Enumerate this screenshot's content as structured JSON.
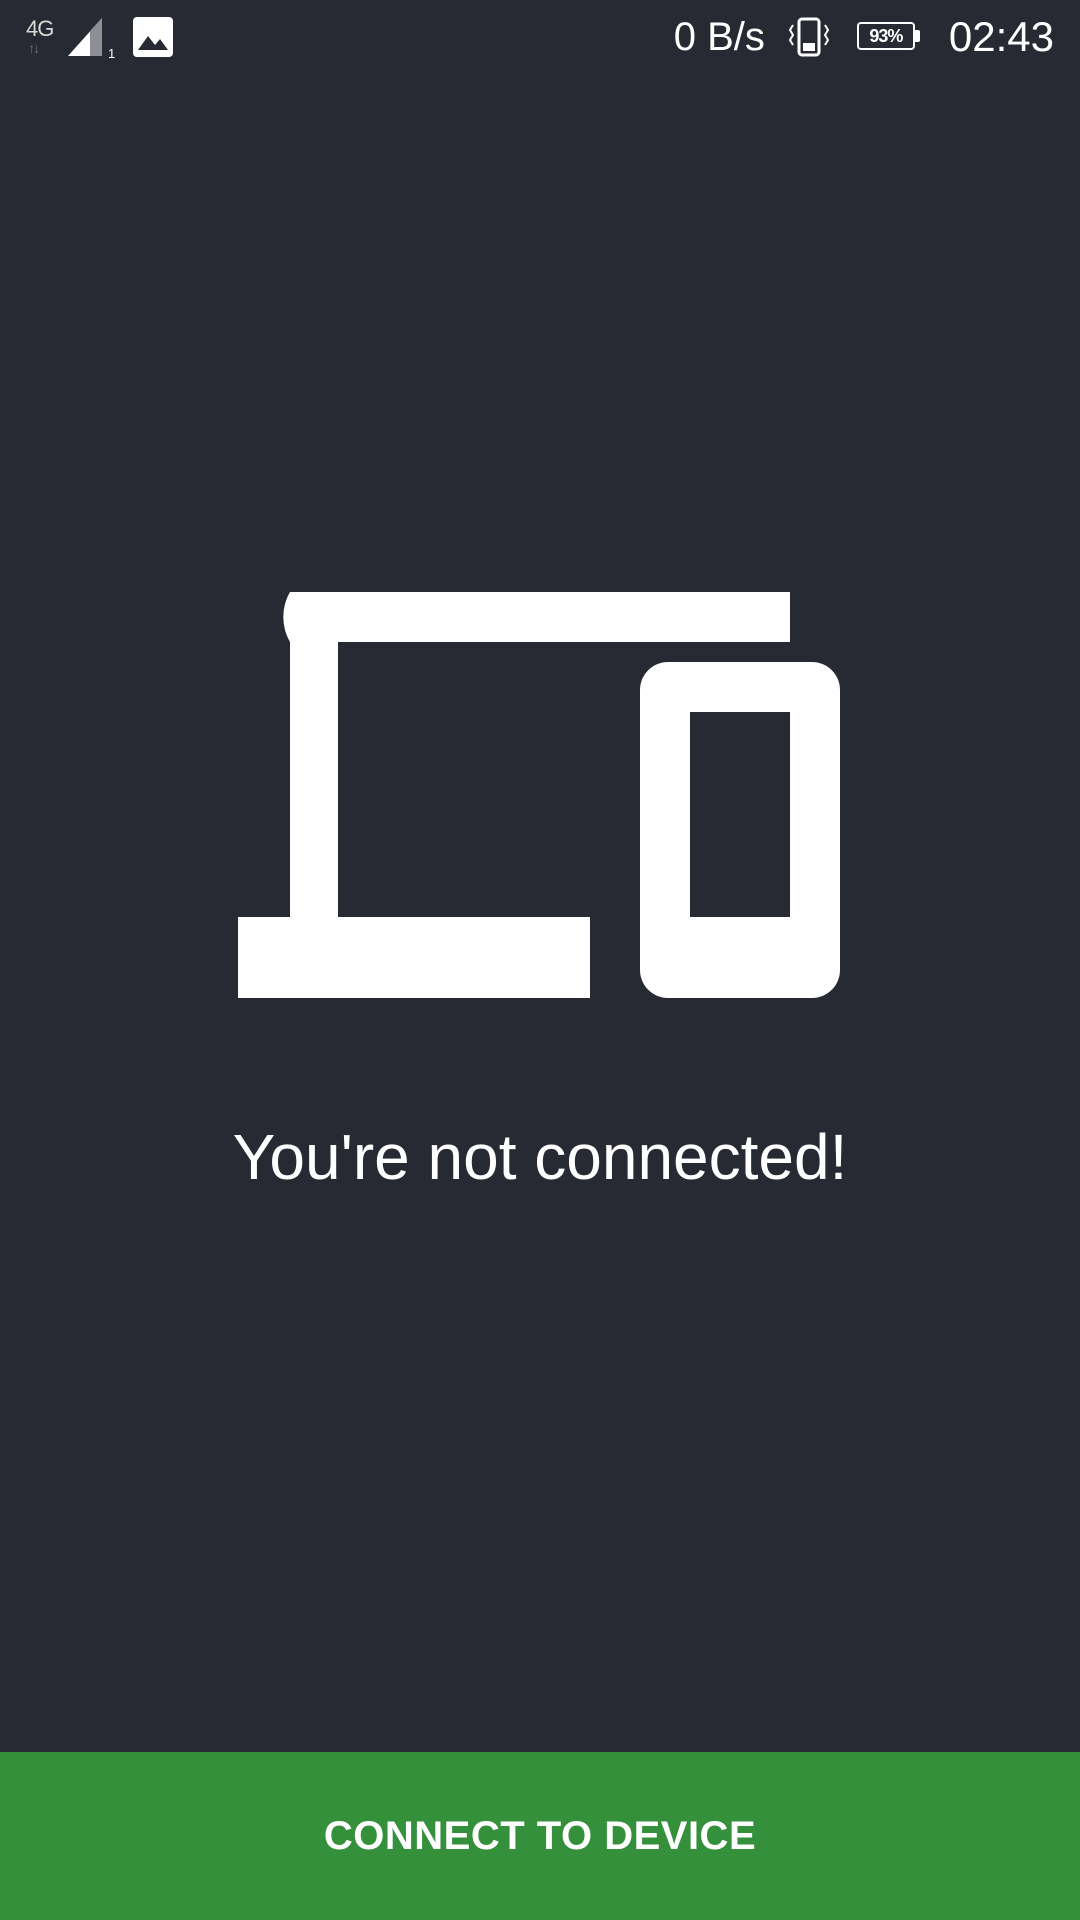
{
  "status_bar": {
    "network_type": "4G",
    "network_arrows": "↑↓",
    "sim_slot": "1",
    "net_speed": "0 B/s",
    "battery_percent": "93%",
    "time": "02:43",
    "icons": [
      "signal-icon",
      "gallery-notification-icon",
      "vibrate-icon",
      "battery-icon"
    ]
  },
  "main": {
    "icon": "devices-icon",
    "message": "You're not connected!"
  },
  "footer": {
    "connect_label": "CONNECT TO DEVICE"
  },
  "colors": {
    "background": "#282a33",
    "button": "#34903b",
    "foreground": "#ffffff"
  }
}
